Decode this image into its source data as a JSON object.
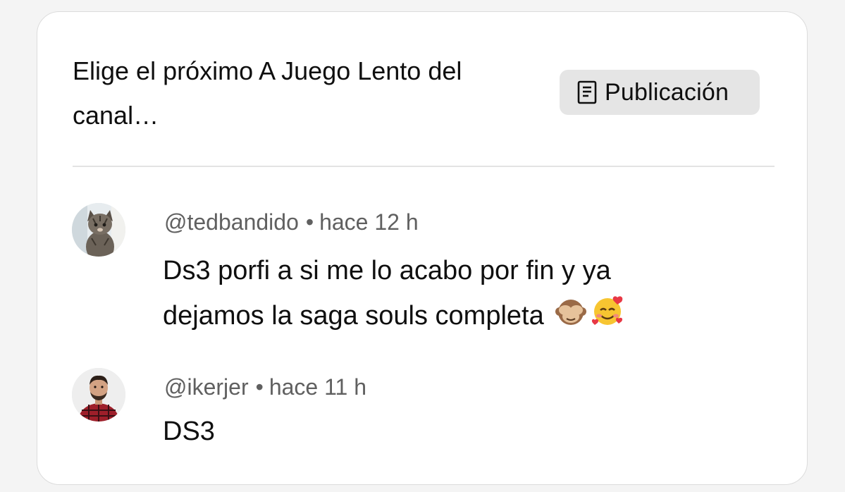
{
  "post": {
    "title": "Elige el próximo A Juego Lento del canal…",
    "badge_label": "Publicación",
    "badge_icon": "post-document-icon"
  },
  "comments": [
    {
      "author": "@tedbandido",
      "separator": "•",
      "time": "hace 12 h",
      "text_line1": "Ds3 porfi a si me lo acabo por fin y ya",
      "text_line2": "dejamos la saga souls completa",
      "emojis": [
        "see-no-evil-monkey-emoji",
        "smiling-face-with-hearts-emoji"
      ],
      "avatar": "cat-avatar"
    },
    {
      "author": "@ikerjer",
      "separator": "•",
      "time": "hace 11 h",
      "text_line1": "DS3",
      "avatar": "man-avatar"
    }
  ]
}
